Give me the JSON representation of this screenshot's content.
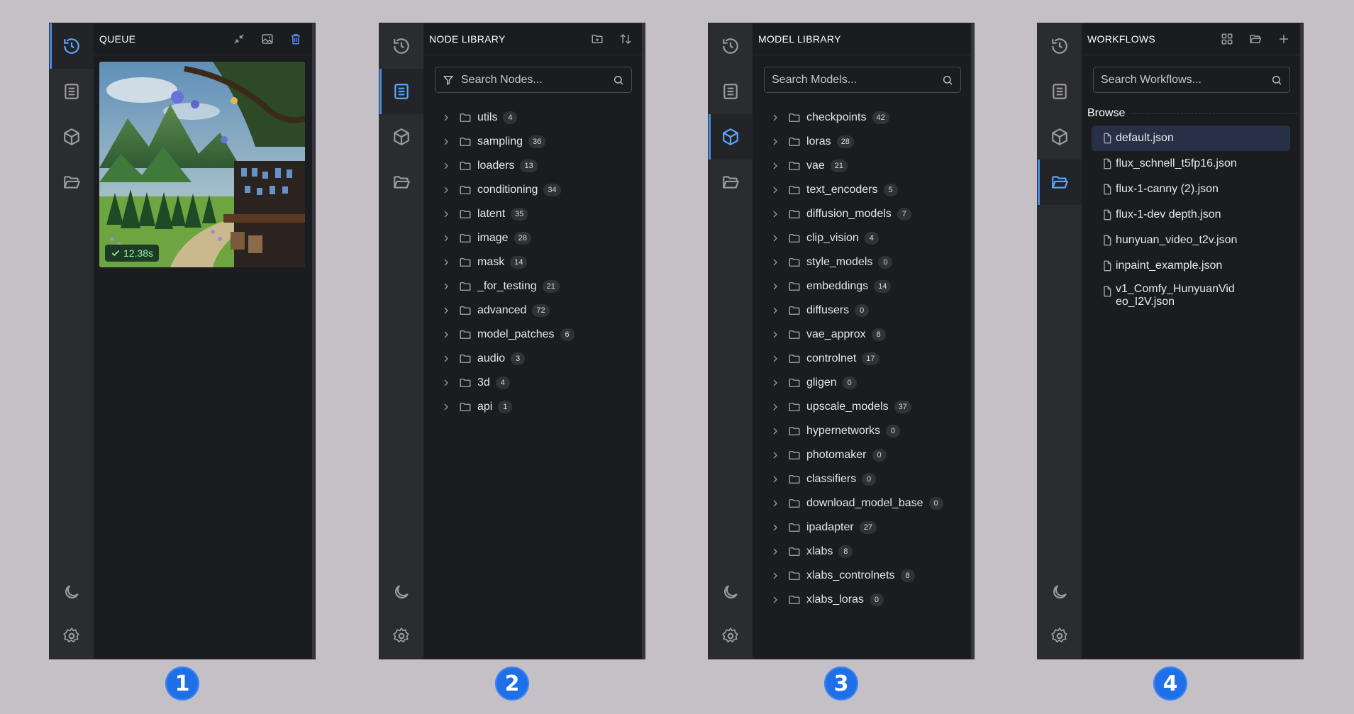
{
  "panels": {
    "queue": {
      "title": "QUEUE",
      "duration": "12.38s",
      "number": "1"
    },
    "node_library": {
      "title": "NODE LIBRARY",
      "search_placeholder": "Search Nodes...",
      "number": "2",
      "items": [
        {
          "label": "utils",
          "count": "4"
        },
        {
          "label": "sampling",
          "count": "36"
        },
        {
          "label": "loaders",
          "count": "13"
        },
        {
          "label": "conditioning",
          "count": "34"
        },
        {
          "label": "latent",
          "count": "35"
        },
        {
          "label": "image",
          "count": "28"
        },
        {
          "label": "mask",
          "count": "14"
        },
        {
          "label": "_for_testing",
          "count": "21"
        },
        {
          "label": "advanced",
          "count": "72"
        },
        {
          "label": "model_patches",
          "count": "6"
        },
        {
          "label": "audio",
          "count": "3"
        },
        {
          "label": "3d",
          "count": "4"
        },
        {
          "label": "api",
          "count": "1"
        }
      ]
    },
    "model_library": {
      "title": "MODEL LIBRARY",
      "search_placeholder": "Search Models...",
      "number": "3",
      "items": [
        {
          "label": "checkpoints",
          "count": "42"
        },
        {
          "label": "loras",
          "count": "28"
        },
        {
          "label": "vae",
          "count": "21"
        },
        {
          "label": "text_encoders",
          "count": "5"
        },
        {
          "label": "diffusion_models",
          "count": "7"
        },
        {
          "label": "clip_vision",
          "count": "4"
        },
        {
          "label": "style_models",
          "count": "0"
        },
        {
          "label": "embeddings",
          "count": "14"
        },
        {
          "label": "diffusers",
          "count": "0"
        },
        {
          "label": "vae_approx",
          "count": "8"
        },
        {
          "label": "controlnet",
          "count": "17"
        },
        {
          "label": "gligen",
          "count": "0"
        },
        {
          "label": "upscale_models",
          "count": "37"
        },
        {
          "label": "hypernetworks",
          "count": "0"
        },
        {
          "label": "photomaker",
          "count": "0"
        },
        {
          "label": "classifiers",
          "count": "0"
        },
        {
          "label": "download_model_base",
          "count": "0"
        },
        {
          "label": "ipadapter",
          "count": "27"
        },
        {
          "label": "xlabs",
          "count": "8"
        },
        {
          "label": "xlabs_controlnets",
          "count": "8"
        },
        {
          "label": "xlabs_loras",
          "count": "0"
        }
      ]
    },
    "workflows": {
      "title": "WORKFLOWS",
      "search_placeholder": "Search Workflows...",
      "browse_label": "Browse",
      "number": "4",
      "items": [
        {
          "label": "default.json"
        },
        {
          "label": "flux_schnell_t5fp16.json"
        },
        {
          "label": "flux-1-canny (2).json"
        },
        {
          "label": "flux-1-dev depth.json"
        },
        {
          "label": "hunyuan_video_t2v.json"
        },
        {
          "label": "inpaint_example.json"
        },
        {
          "label": "v1_Comfy_HunyuanVideo_I2V.json"
        }
      ]
    }
  },
  "icons": [
    "history-icon",
    "node-library-icon",
    "model-library-icon",
    "workflows-icon",
    "moon-icon",
    "gear-icon",
    "collapse-icon",
    "image-icon",
    "trash-icon",
    "new-folder-icon",
    "sort-icon",
    "filter-icon",
    "search-icon",
    "grid-icon",
    "open-folder-icon",
    "plus-icon",
    "chevron-right-icon",
    "folder-icon",
    "file-icon",
    "check-icon"
  ],
  "colors": {
    "background": "#c4c0c6",
    "panel": "#1b1c1f",
    "rail": "#2b2c30",
    "accent": "#5aa8ff",
    "badge_number": "#1e6fe8",
    "selected_row": "#283047"
  }
}
